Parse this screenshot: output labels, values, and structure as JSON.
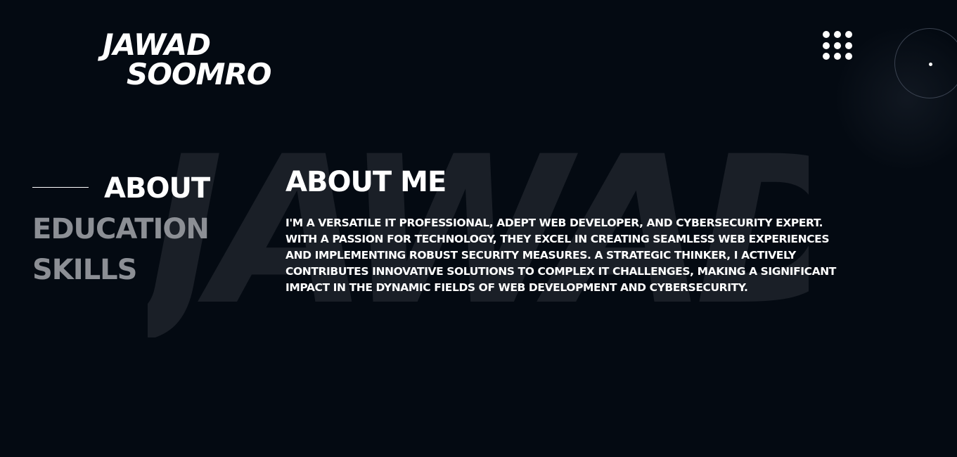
{
  "header": {
    "logo_line1": "JAWAD",
    "logo_line2": "SOOMRO",
    "menu_icon": "grid-dots-icon"
  },
  "background": {
    "watermark": "JAWAD"
  },
  "side_nav": {
    "items": [
      {
        "label": "ABOUT",
        "active": true
      },
      {
        "label": "EDUCATION",
        "active": false
      },
      {
        "label": "SKILLS",
        "active": false
      }
    ]
  },
  "about": {
    "title": "ABOUT ME",
    "body": "I'M A VERSATILE IT PROFESSIONAL, ADEPT WEB DEVELOPER, AND CYBERSECURITY EXPERT. WITH A PASSION FOR TECHNOLOGY, THEY EXCEL IN CREATING SEAMLESS WEB EXPERIENCES AND IMPLEMENTING ROBUST SECURITY MEASURES. A STRATEGIC THINKER, I ACTIVELY CONTRIBUTES INNOVATIVE SOLUTIONS TO COMPLEX IT CHALLENGES, MAKING A SIGNIFICANT IMPACT IN THE DYNAMIC FIELDS OF WEB DEVELOPMENT AND CYBERSECURITY."
  },
  "colors": {
    "background": "#040a12",
    "text": "#ffffff",
    "inactive_nav": "#8c8f95",
    "watermark": "#1a1f27"
  }
}
